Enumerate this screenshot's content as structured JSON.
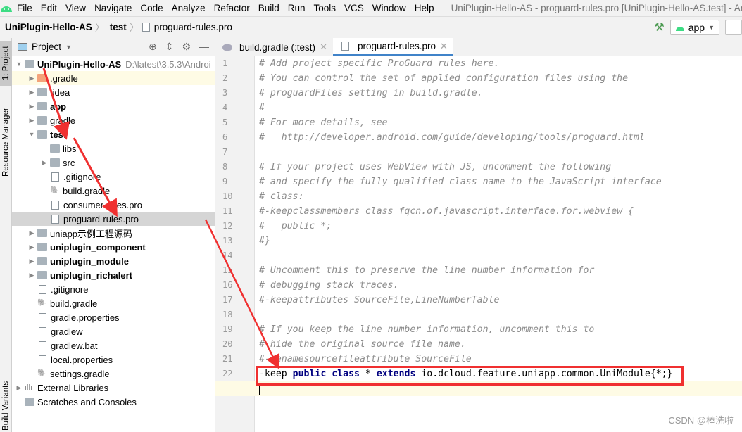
{
  "menu": {
    "items": [
      "File",
      "Edit",
      "View",
      "Navigate",
      "Code",
      "Analyze",
      "Refactor",
      "Build",
      "Run",
      "Tools",
      "VCS",
      "Window",
      "Help"
    ],
    "window_title": "UniPlugin-Hello-AS - proguard-rules.pro [UniPlugin-Hello-AS.test] - Andr"
  },
  "breadcrumb": [
    "UniPlugin-Hello-AS",
    "test",
    "proguard-rules.pro"
  ],
  "toolbar": {
    "run_config": "app"
  },
  "side_tabs": {
    "project": "1: Project",
    "resource_manager": "Resource Manager",
    "build_variants": "Build Variants"
  },
  "panel": {
    "title": "Project"
  },
  "tree": [
    {
      "label": "UniPlugin-Hello-AS",
      "path": "D:\\latest\\3.5.3\\Androi",
      "bold": true,
      "depth": 0,
      "arrow": "down",
      "icon": "module"
    },
    {
      "label": ".gradle",
      "depth": 1,
      "arrow": "right",
      "icon": "folder-orange",
      "hl": true
    },
    {
      "label": ".idea",
      "depth": 1,
      "arrow": "right",
      "icon": "folder"
    },
    {
      "label": "app",
      "bold": true,
      "depth": 1,
      "arrow": "right",
      "icon": "android-module"
    },
    {
      "label": "gradle",
      "depth": 1,
      "arrow": "right",
      "icon": "folder"
    },
    {
      "label": "test",
      "bold": true,
      "depth": 1,
      "arrow": "down",
      "icon": "module"
    },
    {
      "label": "libs",
      "depth": 2,
      "arrow": "",
      "icon": "folder"
    },
    {
      "label": "src",
      "depth": 2,
      "arrow": "right",
      "icon": "folder"
    },
    {
      "label": ".gitignore",
      "depth": 2,
      "arrow": "",
      "icon": "file"
    },
    {
      "label": "build.gradle",
      "depth": 2,
      "arrow": "",
      "icon": "gradle"
    },
    {
      "label": "consumer-rules.pro",
      "depth": 2,
      "arrow": "",
      "icon": "file"
    },
    {
      "label": "proguard-rules.pro",
      "depth": 2,
      "arrow": "",
      "icon": "file",
      "sel": true
    },
    {
      "label": "uniapp示例工程源码",
      "depth": 1,
      "arrow": "right",
      "icon": "folder"
    },
    {
      "label": "uniplugin_component",
      "bold": true,
      "depth": 1,
      "arrow": "right",
      "icon": "module"
    },
    {
      "label": "uniplugin_module",
      "bold": true,
      "depth": 1,
      "arrow": "right",
      "icon": "module"
    },
    {
      "label": "uniplugin_richalert",
      "bold": true,
      "depth": 1,
      "arrow": "right",
      "icon": "module"
    },
    {
      "label": ".gitignore",
      "depth": 1,
      "arrow": "",
      "icon": "file"
    },
    {
      "label": "build.gradle",
      "depth": 1,
      "arrow": "",
      "icon": "gradle"
    },
    {
      "label": "gradle.properties",
      "depth": 1,
      "arrow": "",
      "icon": "file"
    },
    {
      "label": "gradlew",
      "depth": 1,
      "arrow": "",
      "icon": "file"
    },
    {
      "label": "gradlew.bat",
      "depth": 1,
      "arrow": "",
      "icon": "file"
    },
    {
      "label": "local.properties",
      "depth": 1,
      "arrow": "",
      "icon": "file"
    },
    {
      "label": "settings.gradle",
      "depth": 1,
      "arrow": "",
      "icon": "gradle"
    },
    {
      "label": "External Libraries",
      "depth": 0,
      "arrow": "right",
      "icon": "library"
    },
    {
      "label": "Scratches and Consoles",
      "depth": 0,
      "arrow": "",
      "icon": "scratch"
    }
  ],
  "tabs": [
    {
      "label": "build.gradle (:test)",
      "active": false
    },
    {
      "label": "proguard-rules.pro",
      "active": true
    }
  ],
  "code": [
    "# Add project specific ProGuard rules here.",
    "# You can control the set of applied configuration files using the",
    "# proguardFiles setting in build.gradle.",
    "#",
    "# For more details, see",
    "#   http://developer.android.com/guide/developing/tools/proguard.html",
    "",
    "# If your project uses WebView with JS, uncomment the following",
    "# and specify the fully qualified class name to the JavaScript interface",
    "# class:",
    "#-keepclassmembers class fqcn.of.javascript.interface.for.webview {",
    "#   public *;",
    "#}",
    "",
    "# Uncomment this to preserve the line number information for",
    "# debugging stack traces.",
    "#-keepattributes SourceFile,LineNumberTable",
    "",
    "# If you keep the line number information, uncomment this to",
    "# hide the original source file name.",
    "#-renamesourcefileattribute SourceFile",
    "-keep public class * extends io.dcloud.feature.uniapp.common.UniModule{*;}",
    ""
  ],
  "watermark": "CSDN @棒洗啦",
  "colors": {
    "accent": "#4083c9",
    "annotation": "#f03030",
    "keyword": "#000080",
    "comment": "#8c8c8c",
    "current_line": "#fefbe5"
  }
}
